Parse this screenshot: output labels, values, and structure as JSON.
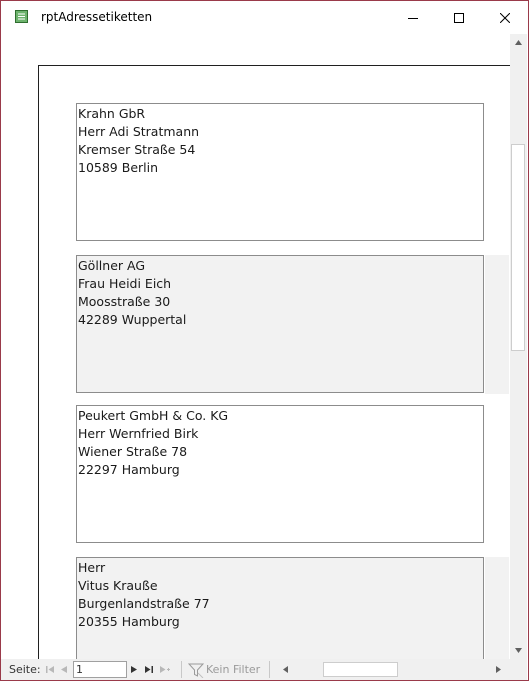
{
  "window": {
    "title": "rptAdressetiketten",
    "icon": "report-icon",
    "controls": [
      "minimize-icon",
      "maximize-icon",
      "close-icon"
    ]
  },
  "labels": [
    {
      "lines": [
        "Krahn GbR",
        "Herr Adi Stratmann",
        "Kremser Straße 54",
        "10589 Berlin"
      ],
      "shaded": false
    },
    {
      "lines": [
        "Göllner AG",
        "Frau Heidi Eich",
        "Moosstraße 30",
        "42289 Wuppertal"
      ],
      "shaded": true
    },
    {
      "lines": [
        "Peukert GmbH & Co. KG",
        "Herr Wernfried Birk",
        "Wiener Straße 78",
        "22297 Hamburg"
      ],
      "shaded": false
    },
    {
      "lines": [
        "Herr",
        "Vitus Krauße",
        "Burgenlandstraße 77",
        "20355 Hamburg"
      ],
      "shaded": true
    }
  ],
  "navigation": {
    "page_label": "Seite:",
    "page_value": "1",
    "filter_label": "Kein Filter"
  },
  "colors": {
    "window_border": "#9a3a4a",
    "alt_band": "#f2f2f2",
    "label_border": "#8c8c8c"
  }
}
